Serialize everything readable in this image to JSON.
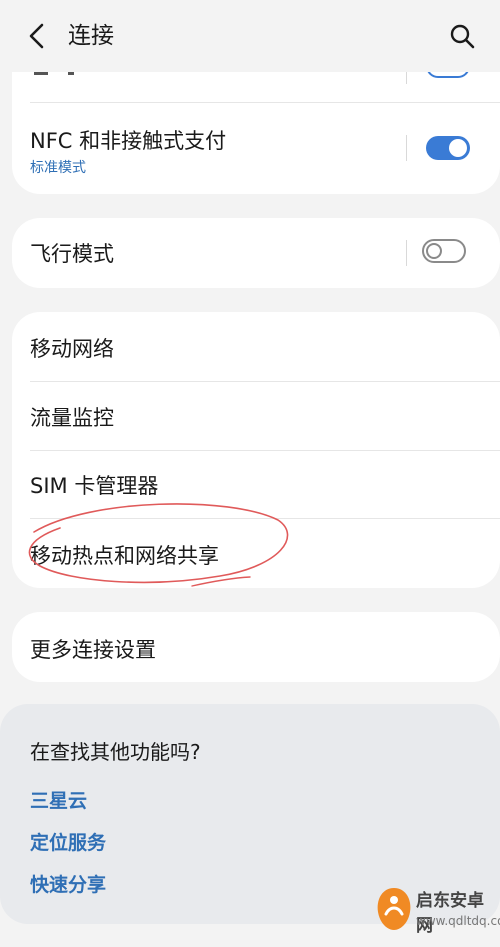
{
  "header": {
    "title": "连接",
    "back_icon": "chevron-left-icon",
    "search_icon": "search-icon"
  },
  "nfc": {
    "label": "NFC 和非接触式支付",
    "sublabel": "标准模式",
    "toggle": "on"
  },
  "airplane": {
    "label": "飞行模式",
    "toggle": "off"
  },
  "network_group": {
    "items": [
      {
        "label": "移动网络"
      },
      {
        "label": "流量监控"
      },
      {
        "label": "SIM 卡管理器"
      },
      {
        "label": "移动热点和网络共享"
      }
    ]
  },
  "more": {
    "label": "更多连接设置"
  },
  "suggestions": {
    "title": "在查找其他功能吗?",
    "links": [
      {
        "label": "三星云"
      },
      {
        "label": "定位服务"
      },
      {
        "label": "快速分享"
      }
    ]
  },
  "watermark": {
    "name": "启东安卓网",
    "url": "www.qdltdq.com"
  },
  "colors": {
    "accent": "#3a7bd5",
    "link": "#2f6fb5",
    "background": "#f3f3f3",
    "annotation": "#e05a5a"
  }
}
